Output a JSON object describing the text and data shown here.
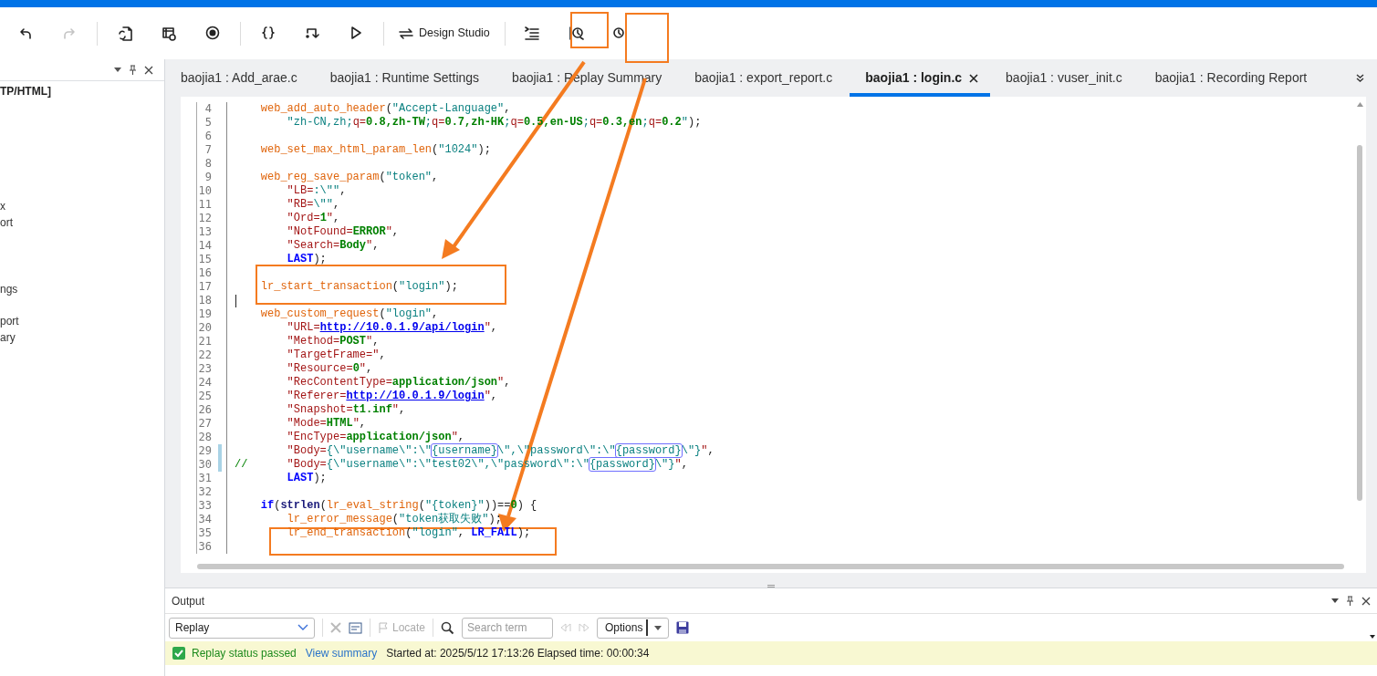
{
  "toolbar": {
    "items": [
      {
        "kind": "undo",
        "disabled": false
      },
      {
        "kind": "redo",
        "disabled": true
      },
      {
        "kind": "sep"
      },
      {
        "kind": "regenerate"
      },
      {
        "kind": "snapshot"
      },
      {
        "kind": "record"
      },
      {
        "kind": "sep"
      },
      {
        "kind": "braces"
      },
      {
        "kind": "step"
      },
      {
        "kind": "play"
      },
      {
        "kind": "sep"
      },
      {
        "kind": "design",
        "label": "Design Studio"
      },
      {
        "kind": "sep"
      },
      {
        "kind": "lines"
      },
      {
        "kind": "start-trans"
      },
      {
        "kind": "end-trans"
      }
    ]
  },
  "left_panel": {
    "items": [
      {
        "label": "TP/HTML]",
        "kind": "root"
      },
      {
        "label": "x",
        "kind": "item"
      },
      {
        "label": "ort",
        "kind": "item"
      },
      {
        "label": "ngs",
        "kind": "item"
      },
      {
        "label": "port",
        "kind": "item"
      },
      {
        "label": "ary",
        "kind": "item"
      }
    ]
  },
  "tabs": [
    {
      "label": "baojia1 : Add_arae.c",
      "selected": false
    },
    {
      "label": "baojia1 : Runtime Settings",
      "selected": false
    },
    {
      "label": "baojia1 : Replay Summary",
      "selected": false
    },
    {
      "label": "baojia1 : export_report.c",
      "selected": false
    },
    {
      "label": "baojia1 : login.c",
      "selected": true
    },
    {
      "label": "baojia1 : vuser_init.c",
      "selected": false
    },
    {
      "label": "baojia1 : Recording Report",
      "selected": false
    }
  ],
  "editor": {
    "lines": [
      {
        "number": "4",
        "changed": false,
        "tokens": [
          {
            "kind": "fn",
            "text": "    web_add_auto_header"
          },
          {
            "kind": "plain",
            "text": "("
          },
          {
            "kind": "str",
            "text": "\"Accept-Language\""
          },
          {
            "kind": "plain",
            "text": ","
          }
        ]
      },
      {
        "number": "5",
        "changed": false,
        "tokens": [
          {
            "kind": "str",
            "text": "        \"zh-CN,zh;"
          },
          {
            "kind": "key",
            "text": "q="
          },
          {
            "kind": "val",
            "text": "0.8,zh-TW"
          },
          {
            "kind": "str",
            "text": ";"
          },
          {
            "kind": "key",
            "text": "q="
          },
          {
            "kind": "val",
            "text": "0.7,zh-HK"
          },
          {
            "kind": "str",
            "text": ";"
          },
          {
            "kind": "key",
            "text": "q="
          },
          {
            "kind": "val",
            "text": "0.5,en-US"
          },
          {
            "kind": "str",
            "text": ";"
          },
          {
            "kind": "key",
            "text": "q="
          },
          {
            "kind": "val",
            "text": "0.3,en"
          },
          {
            "kind": "str",
            "text": ";"
          },
          {
            "kind": "key",
            "text": "q="
          },
          {
            "kind": "val",
            "text": "0.2"
          },
          {
            "kind": "str",
            "text": "\""
          },
          {
            "kind": "plain",
            "text": ");"
          }
        ]
      },
      {
        "number": "6",
        "changed": false
      },
      {
        "number": "7",
        "changed": false,
        "tokens": [
          {
            "kind": "fn",
            "text": "    web_set_max_html_param_len"
          },
          {
            "kind": "plain",
            "text": "("
          },
          {
            "kind": "str",
            "text": "\"1024\""
          },
          {
            "kind": "plain",
            "text": ");"
          }
        ]
      },
      {
        "number": "8",
        "changed": false
      },
      {
        "number": "9",
        "changed": false,
        "tokens": [
          {
            "kind": "fn",
            "text": "    web_reg_save_param"
          },
          {
            "kind": "plain",
            "text": "("
          },
          {
            "kind": "str",
            "text": "\"token\""
          },
          {
            "kind": "plain",
            "text": ","
          }
        ]
      },
      {
        "number": "10",
        "changed": false,
        "tokens": [
          {
            "kind": "key",
            "text": "        \"LB="
          },
          {
            "kind": "str",
            "text": ":\\\"\""
          },
          {
            "kind": "plain",
            "text": ","
          }
        ]
      },
      {
        "number": "11",
        "changed": false,
        "tokens": [
          {
            "kind": "key",
            "text": "        \"RB="
          },
          {
            "kind": "str",
            "text": "\\\"\""
          },
          {
            "kind": "plain",
            "text": ","
          }
        ]
      },
      {
        "number": "12",
        "changed": false,
        "tokens": [
          {
            "kind": "key",
            "text": "        \"Ord="
          },
          {
            "kind": "val",
            "text": "1"
          },
          {
            "kind": "key",
            "text": "\""
          },
          {
            "kind": "plain",
            "text": ","
          }
        ]
      },
      {
        "number": "13",
        "changed": false,
        "tokens": [
          {
            "kind": "key",
            "text": "        \"NotFound="
          },
          {
            "kind": "val",
            "text": "ERROR"
          },
          {
            "kind": "key",
            "text": "\""
          },
          {
            "kind": "plain",
            "text": ","
          }
        ]
      },
      {
        "number": "14",
        "changed": false,
        "tokens": [
          {
            "kind": "key",
            "text": "        \"Search="
          },
          {
            "kind": "val",
            "text": "Body"
          },
          {
            "kind": "key",
            "text": "\""
          },
          {
            "kind": "plain",
            "text": ","
          }
        ]
      },
      {
        "number": "15",
        "changed": false,
        "tokens": [
          {
            "kind": "kw",
            "text": "        LAST"
          },
          {
            "kind": "plain",
            "text": ");"
          }
        ]
      },
      {
        "number": "16",
        "changed": false
      },
      {
        "number": "17",
        "changed": false,
        "tokens": [
          {
            "kind": "fn",
            "text": "    lr_start_transaction"
          },
          {
            "kind": "plain",
            "text": "("
          },
          {
            "kind": "str",
            "text": "\"login\""
          },
          {
            "kind": "plain",
            "text": ");"
          }
        ]
      },
      {
        "number": "18",
        "changed": false,
        "cursor": true
      },
      {
        "number": "19",
        "changed": false,
        "tokens": [
          {
            "kind": "fn",
            "text": "    web_custom_request"
          },
          {
            "kind": "plain",
            "text": "("
          },
          {
            "kind": "str",
            "text": "\"login\""
          },
          {
            "kind": "plain",
            "text": ","
          }
        ]
      },
      {
        "number": "20",
        "changed": false,
        "tokens": [
          {
            "kind": "key",
            "text": "        \"URL="
          },
          {
            "kind": "link",
            "text": "http://10.0.1.9/api/login"
          },
          {
            "kind": "key",
            "text": "\""
          },
          {
            "kind": "plain",
            "text": ","
          }
        ]
      },
      {
        "number": "21",
        "changed": false,
        "tokens": [
          {
            "kind": "key",
            "text": "        \"Method="
          },
          {
            "kind": "val",
            "text": "POST"
          },
          {
            "kind": "key",
            "text": "\""
          },
          {
            "kind": "plain",
            "text": ","
          }
        ]
      },
      {
        "number": "22",
        "changed": false,
        "tokens": [
          {
            "kind": "key",
            "text": "        \"TargetFrame=\""
          },
          {
            "kind": "plain",
            "text": ","
          }
        ]
      },
      {
        "number": "23",
        "changed": false,
        "tokens": [
          {
            "kind": "key",
            "text": "        \"Resource="
          },
          {
            "kind": "val",
            "text": "0"
          },
          {
            "kind": "key",
            "text": "\""
          },
          {
            "kind": "plain",
            "text": ","
          }
        ]
      },
      {
        "number": "24",
        "changed": false,
        "tokens": [
          {
            "kind": "key",
            "text": "        \"RecContentType="
          },
          {
            "kind": "val",
            "text": "application/json"
          },
          {
            "kind": "key",
            "text": "\""
          },
          {
            "kind": "plain",
            "text": ","
          }
        ]
      },
      {
        "number": "25",
        "changed": false,
        "tokens": [
          {
            "kind": "key",
            "text": "        \"Referer="
          },
          {
            "kind": "link",
            "text": "http://10.0.1.9/login"
          },
          {
            "kind": "key",
            "text": "\""
          },
          {
            "kind": "plain",
            "text": ","
          }
        ]
      },
      {
        "number": "26",
        "changed": false,
        "tokens": [
          {
            "kind": "key",
            "text": "        \"Snapshot="
          },
          {
            "kind": "val",
            "text": "t1.inf"
          },
          {
            "kind": "key",
            "text": "\""
          },
          {
            "kind": "plain",
            "text": ","
          }
        ]
      },
      {
        "number": "27",
        "changed": false,
        "tokens": [
          {
            "kind": "key",
            "text": "        \"Mode="
          },
          {
            "kind": "val",
            "text": "HTML"
          },
          {
            "kind": "key",
            "text": "\""
          },
          {
            "kind": "plain",
            "text": ","
          }
        ]
      },
      {
        "number": "28",
        "changed": false,
        "tokens": [
          {
            "kind": "key",
            "text": "        \"EncType="
          },
          {
            "kind": "val",
            "text": "application/json"
          },
          {
            "kind": "key",
            "text": "\""
          },
          {
            "kind": "plain",
            "text": ","
          }
        ]
      },
      {
        "number": "29",
        "changed": true,
        "tokens": [
          {
            "kind": "key",
            "text": "        \"Body="
          },
          {
            "kind": "str",
            "text": "{\\\"username\\\":\\\""
          },
          {
            "kind": "param",
            "text": "{username}"
          },
          {
            "kind": "str",
            "text": "\\\",\\\"password\\\":\\\""
          },
          {
            "kind": "param",
            "text": "{password}"
          },
          {
            "kind": "str",
            "text": "\\\"}"
          },
          {
            "kind": "key",
            "text": "\""
          },
          {
            "kind": "plain",
            "text": ","
          }
        ]
      },
      {
        "number": "30",
        "changed": true,
        "tokens": [
          {
            "kind": "comment",
            "text": "//"
          },
          {
            "kind": "key",
            "text": "      \"Body="
          },
          {
            "kind": "str",
            "text": "{\\\"username\\\":\\\"test02\\\",\\\"password\\\":\\\""
          },
          {
            "kind": "param",
            "text": "{password}"
          },
          {
            "kind": "str",
            "text": "\\\"}"
          },
          {
            "kind": "key",
            "text": "\""
          },
          {
            "kind": "plain",
            "text": ","
          }
        ]
      },
      {
        "number": "31",
        "changed": false,
        "tokens": [
          {
            "kind": "kw",
            "text": "        LAST"
          },
          {
            "kind": "plain",
            "text": ");"
          }
        ]
      },
      {
        "number": "32",
        "changed": false
      },
      {
        "number": "33",
        "changed": false,
        "tokens": [
          {
            "kind": "ctl",
            "text": "    if"
          },
          {
            "kind": "plain",
            "text": "("
          },
          {
            "kind": "lib",
            "text": "strlen"
          },
          {
            "kind": "plain",
            "text": "("
          },
          {
            "kind": "fn",
            "text": "lr_eval_string"
          },
          {
            "kind": "plain",
            "text": "("
          },
          {
            "kind": "str",
            "text": "\"{token}\""
          },
          {
            "kind": "plain",
            "text": "))=="
          },
          {
            "kind": "val",
            "text": "0"
          },
          {
            "kind": "plain",
            "text": ") {"
          }
        ]
      },
      {
        "number": "34",
        "changed": false,
        "tokens": [
          {
            "kind": "fn",
            "text": "        lr_error_message"
          },
          {
            "kind": "plain",
            "text": "("
          },
          {
            "kind": "str",
            "text": "\"token获取失败\""
          },
          {
            "kind": "plain",
            "text": ");"
          }
        ]
      },
      {
        "number": "35",
        "changed": false,
        "tokens": [
          {
            "kind": "fn",
            "text": "        lr_end_transaction"
          },
          {
            "kind": "plain",
            "text": "("
          },
          {
            "kind": "str",
            "text": "\"login\""
          },
          {
            "kind": "plain",
            "text": ", "
          },
          {
            "kind": "kw",
            "text": "LR_FAIL"
          },
          {
            "kind": "plain",
            "text": ");"
          }
        ]
      },
      {
        "number": "36",
        "changed": false
      }
    ]
  },
  "output": {
    "title": "Output",
    "dropdown": {
      "value": "Replay"
    },
    "locate": {
      "label": "Locate",
      "disabled": true
    },
    "search": {
      "placeholder": "Search term"
    },
    "options": {
      "label": "Options"
    },
    "status": {
      "text": "Replay status passed",
      "link": "View summary",
      "details": "Started at: 2025/5/12 17:13:26 Elapsed time: 00:00:34"
    }
  }
}
